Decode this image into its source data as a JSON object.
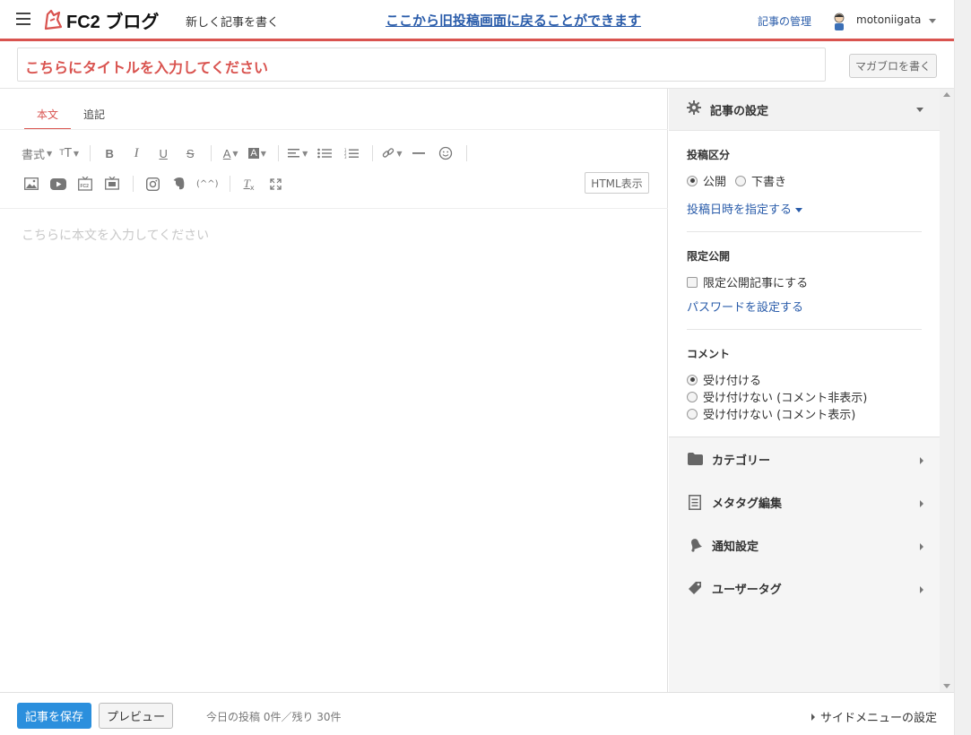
{
  "header": {
    "logo_text": "FC2 ブログ",
    "new_post_label": "新しく記事を書く",
    "old_editor_link": "ここから旧投稿画面に戻ることができます",
    "manage_label": "記事の管理",
    "username": "motoniigata"
  },
  "title_bar": {
    "placeholder": "こちらにタイトルを入力してください",
    "magablo_button": "マガブロを書く"
  },
  "editor": {
    "tabs": [
      {
        "label": "本文",
        "active": true
      },
      {
        "label": "追記",
        "active": false
      }
    ],
    "toolbar": {
      "format_label": "書式",
      "html_button": "HTML表示"
    },
    "body_placeholder": "こちらに本文を入力してください"
  },
  "sidebar": {
    "header": "記事の設定",
    "post_type": {
      "title": "投稿区分",
      "options": [
        "公開",
        "下書き"
      ],
      "selected": "公開",
      "schedule_link": "投稿日時を指定する"
    },
    "restricted": {
      "title": "限定公開",
      "checkbox_label": "限定公開記事にする",
      "checked": false,
      "password_link": "パスワードを設定する"
    },
    "comments": {
      "title": "コメント",
      "options": [
        "受け付ける",
        "受け付けない (コメント非表示)",
        "受け付けない (コメント表示)"
      ],
      "selected": "受け付ける"
    },
    "sections": [
      {
        "label": "カテゴリー",
        "icon": "folder-icon"
      },
      {
        "label": "メタタグ編集",
        "icon": "document-icon"
      },
      {
        "label": "通知設定",
        "icon": "bell-icon"
      },
      {
        "label": "ユーザータグ",
        "icon": "tag-icon"
      }
    ]
  },
  "footer": {
    "save_button": "記事を保存",
    "preview_button": "プレビュー",
    "post_count": "今日の投稿 0件／残り 30件",
    "side_menu_settings": "サイドメニューの設定"
  },
  "colors": {
    "accent_red": "#d9534f",
    "link_blue": "#2a5caa",
    "save_blue": "#2b8fdd"
  }
}
